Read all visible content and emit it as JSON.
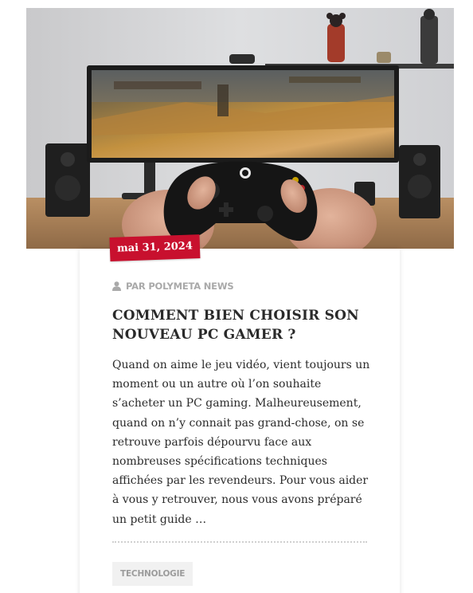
{
  "post": {
    "date": "mai 31, 2024",
    "author": "PAR POLYMETA NEWS",
    "title": "COMMENT BIEN CHOISIR SON NOUVEAU PC GAMER ?",
    "excerpt": "Quand on aime le jeu vidéo, vient toujours un moment ou un autre où l’on souhaite s’acheter un PC gaming. Malheureusement, quand on n’y connait pas grand-chose, on se retrouve parfois dépourvu face aux nombreuses spécifications techniques affichées par les revendeurs. Pour vous aider à vous y retrouver, nous vous avons préparé un petit guide …",
    "tag": "TECHNOLOGIE"
  },
  "colors": {
    "accent": "#c8102e",
    "meta_text": "#a9a9a9",
    "title_text": "#2a2a2a",
    "tag_bg": "#f1f1f1"
  },
  "icons": {
    "author": "user-icon",
    "hero": "gaming-setup-photo"
  }
}
